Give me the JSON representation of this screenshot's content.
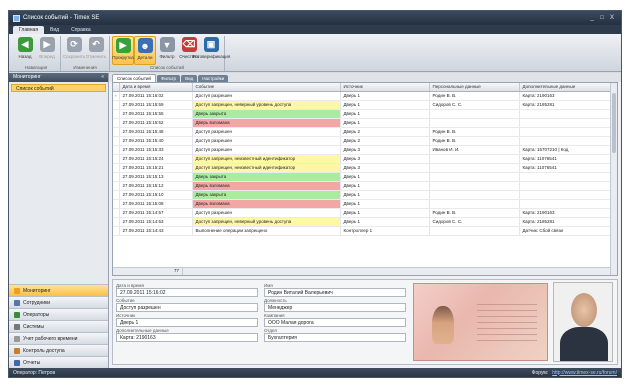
{
  "window": {
    "title": "Список событий - Timex SE",
    "controls": [
      "_",
      "□",
      "X"
    ]
  },
  "menu_tabs": [
    "Главная",
    "Вид",
    "Справка"
  ],
  "ribbon": {
    "groups": [
      {
        "caption": "Навигация",
        "buttons": [
          {
            "label": "Назад",
            "icon": "back-arrow-icon",
            "color": "#3c9a3c",
            "glyph": "◀"
          },
          {
            "label": "Вперед",
            "icon": "forward-arrow-icon",
            "color": "#9aa3ad",
            "glyph": "▶"
          }
        ]
      },
      {
        "caption": "Изменения",
        "buttons": [
          {
            "label": "Сохранить",
            "icon": "save-icon",
            "color": "#9aa3ad",
            "glyph": "⟳"
          },
          {
            "label": "Отменить",
            "icon": "undo-icon",
            "color": "#9aa3ad",
            "glyph": "↶"
          }
        ]
      },
      {
        "caption": "Список событий",
        "buttons": [
          {
            "label": "Прокрутка",
            "icon": "play-scroll-icon",
            "color": "#3aa13a",
            "glyph": "▶"
          },
          {
            "label": "Детали",
            "icon": "person-details-icon",
            "color": "#3b6fb5",
            "glyph": "☻"
          },
          {
            "label": "Фильтр",
            "icon": "filter-icon",
            "color": "#8a96a5",
            "glyph": "▼"
          },
          {
            "label": "Очистить",
            "icon": "eraser-icon",
            "color": "#c63b3b",
            "glyph": "⌫"
          },
          {
            "label": "Фотоверификация",
            "icon": "photo-verification-icon",
            "color": "#2c6aa8",
            "glyph": "▣"
          }
        ]
      }
    ]
  },
  "sidebar": {
    "header": "Мониторинг",
    "collapse_glyph": "«",
    "selected_item": "Список событий",
    "nav": [
      {
        "label": "Мониторинг",
        "icon": "monitoring-icon",
        "color": "#f0a020"
      },
      {
        "label": "Сотрудники",
        "icon": "employees-icon",
        "color": "#5577aa"
      },
      {
        "label": "Операторы",
        "icon": "operators-icon",
        "color": "#3c8a3c"
      },
      {
        "label": "Системы",
        "icon": "systems-icon",
        "color": "#777777"
      },
      {
        "label": "Учет рабочего времени",
        "icon": "time-tracking-icon",
        "color": "#999999"
      },
      {
        "label": "Контроль доступа",
        "icon": "access-control-icon",
        "color": "#c08030"
      },
      {
        "label": "Отчеты",
        "icon": "reports-icon",
        "color": "#4466aa"
      }
    ]
  },
  "content_tabs": [
    "Список событий",
    "Фильтр",
    "Вид",
    "Настройки"
  ],
  "grid": {
    "columns": [
      "Дата и время",
      "Событие",
      "Источник",
      "Персональные данные",
      "Дополнительные данные"
    ],
    "rows": [
      {
        "date": "27.09.2011 15:16:02",
        "event": "Доступ разрешен",
        "source": "Дверь 1",
        "person": "Родин В. В.",
        "extra": "Карта: 2190163",
        "color": "white",
        "current": true
      },
      {
        "date": "27.09.2011 15:15:59",
        "event": "Доступ запрещен, неверный уровень доступа",
        "source": "Дверь 1",
        "person": "Сидоров С. С.",
        "extra": "Карта: 2185281",
        "color": "yellow"
      },
      {
        "date": "27.09.2011 15:15:55",
        "event": "Дверь закрыта",
        "source": "Дверь 1",
        "person": "",
        "extra": "",
        "color": "green"
      },
      {
        "date": "27.09.2011 15:15:52",
        "event": "Дверь взломана",
        "source": "Дверь 1",
        "person": "",
        "extra": "",
        "color": "red"
      },
      {
        "date": "27.09.2011 15:15:48",
        "event": "Доступ разрешен",
        "source": "Дверь 2",
        "person": "Родин В. В.",
        "extra": "",
        "color": "white"
      },
      {
        "date": "27.09.2011 15:15:40",
        "event": "Доступ разрешен",
        "source": "Дверь 2",
        "person": "Родин В. В.",
        "extra": "",
        "color": "white"
      },
      {
        "date": "27.09.2011 15:15:33",
        "event": "Доступ разрешен",
        "source": "Дверь 3",
        "person": "Иванов И. И.",
        "extra": "Карта: 15707210 | Код",
        "color": "white"
      },
      {
        "date": "27.09.2011 15:15:24",
        "event": "Доступ запрещен, неизвестный идентификатор",
        "source": "Дверь 3",
        "person": "",
        "extra": "Карта: 11076541",
        "color": "yellow"
      },
      {
        "date": "27.09.2011 15:15:21",
        "event": "Доступ запрещен, неизвестный идентификатор",
        "source": "Дверь 3",
        "person": "",
        "extra": "Карта: 11076541",
        "color": "yellow"
      },
      {
        "date": "27.09.2011 15:15:13",
        "event": "Дверь закрыта",
        "source": "Дверь 1",
        "person": "",
        "extra": "",
        "color": "green"
      },
      {
        "date": "27.09.2011 15:15:12",
        "event": "Дверь взломана",
        "source": "Дверь 1",
        "person": "",
        "extra": "",
        "color": "red"
      },
      {
        "date": "27.09.2011 15:15:10",
        "event": "Дверь закрыта",
        "source": "Дверь 1",
        "person": "",
        "extra": "",
        "color": "green"
      },
      {
        "date": "27.09.2011 15:15:08",
        "event": "Дверь взломана",
        "source": "Дверь 1",
        "person": "",
        "extra": "",
        "color": "red"
      },
      {
        "date": "27.09.2011 15:14:57",
        "event": "Доступ разрешен",
        "source": "Дверь 1",
        "person": "Родин В. В.",
        "extra": "Карта: 2190163",
        "color": "white"
      },
      {
        "date": "27.09.2011 15:14:53",
        "event": "Доступ запрещен, неверный уровень доступа",
        "source": "Дверь 1",
        "person": "Сидоров С. С.",
        "extra": "Карта: 2185281",
        "color": "yellow"
      },
      {
        "date": "27.09.2011 15:14:43",
        "event": "Выполнение операции запрещено",
        "source": "Контроллер 1",
        "person": "",
        "extra": "Датчик: Сбой связи",
        "color": "white"
      }
    ],
    "count": "77"
  },
  "details": {
    "left": [
      {
        "label": "Дата и время",
        "value": "27.09.2011 15:16:02"
      },
      {
        "label": "Событие",
        "value": "Доступ разрешен"
      },
      {
        "label": "Источник",
        "value": "Дверь 1"
      },
      {
        "label": "Дополнительные данные",
        "value": "Карта: 2190163"
      }
    ],
    "right": [
      {
        "label": "Имя",
        "value": "Родин Виталий Валерьевич"
      },
      {
        "label": "Должность",
        "value": "Менеджер"
      },
      {
        "label": "Компания",
        "value": "ООО Малая дорога"
      },
      {
        "label": "Отдел",
        "value": "Бухгалтерия"
      }
    ]
  },
  "status": {
    "operator": "Оператор: Петров",
    "right_label": "Форум:",
    "link": "http://www.timex-se.ru/forum/"
  }
}
